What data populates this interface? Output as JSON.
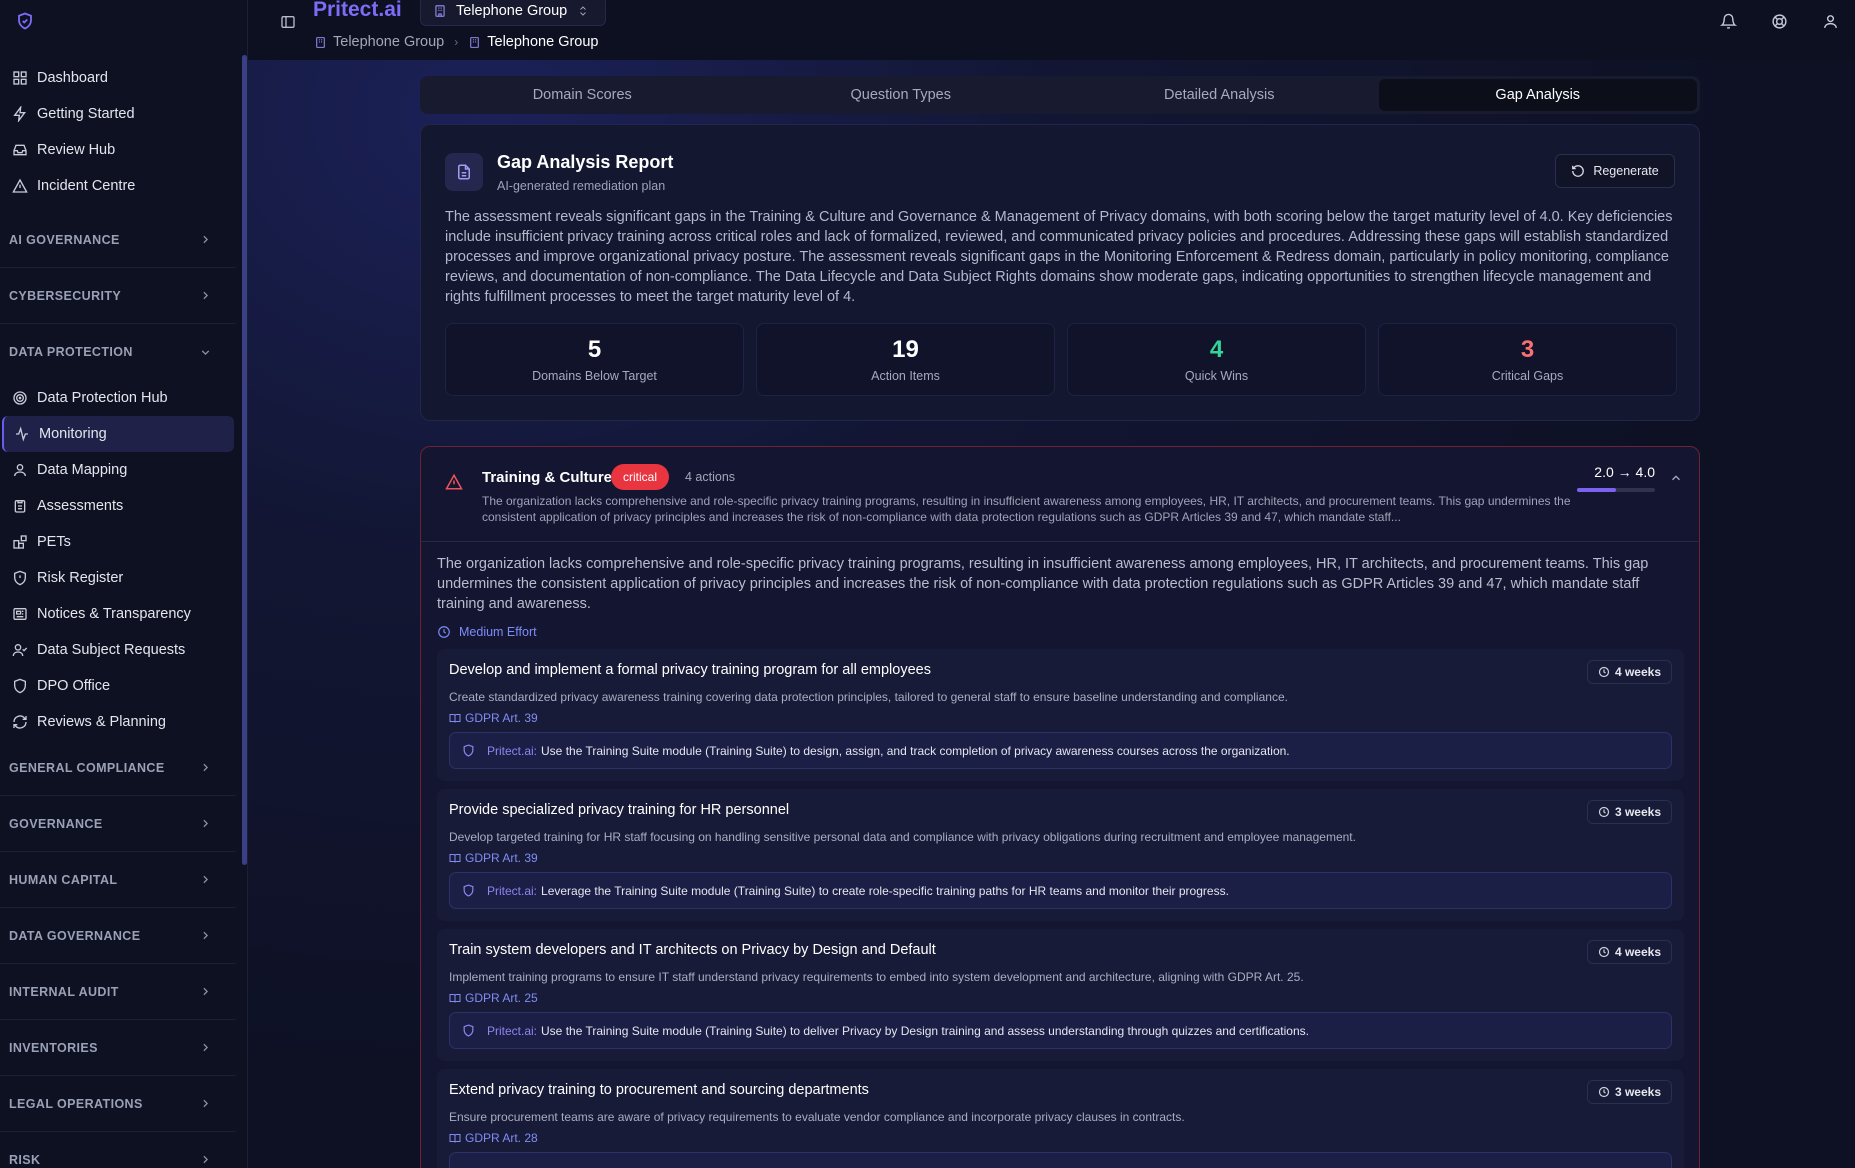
{
  "header": {
    "brand": "Pritect.ai",
    "org_select": "Telephone Group",
    "breadcrumb": [
      "Telephone Group",
      "Telephone Group"
    ]
  },
  "sidebar": {
    "top_items": [
      {
        "label": "Dashboard",
        "icon": "grid-icon"
      },
      {
        "label": "Getting Started",
        "icon": "bolt-icon"
      },
      {
        "label": "Review Hub",
        "icon": "inbox-icon"
      },
      {
        "label": "Incident Centre",
        "icon": "alert-triangle-icon"
      }
    ],
    "sections_before": [
      "AI GOVERNANCE",
      "CYBERSECURITY"
    ],
    "open_section": "DATA PROTECTION",
    "open_items": [
      {
        "label": "Data Protection Hub",
        "icon": "target-icon"
      },
      {
        "label": "Monitoring",
        "icon": "activity-icon",
        "active": true
      },
      {
        "label": "Data Mapping",
        "icon": "map-pin-icon"
      },
      {
        "label": "Assessments",
        "icon": "clipboard-icon"
      },
      {
        "label": "PETs",
        "icon": "blocks-icon"
      },
      {
        "label": "Risk Register",
        "icon": "shield-alert-icon"
      },
      {
        "label": "Notices & Transparency",
        "icon": "newspaper-icon"
      },
      {
        "label": "Data Subject Requests",
        "icon": "user-check-icon"
      },
      {
        "label": "DPO Office",
        "icon": "shield-icon"
      },
      {
        "label": "Reviews & Planning",
        "icon": "refresh-icon"
      }
    ],
    "sections_after": [
      "GENERAL COMPLIANCE",
      "GOVERNANCE",
      "HUMAN CAPITAL",
      "DATA GOVERNANCE",
      "INTERNAL AUDIT",
      "INVENTORIES",
      "LEGAL OPERATIONS",
      "RISK"
    ]
  },
  "tabs": [
    "Domain Scores",
    "Question Types",
    "Detailed Analysis",
    "Gap Analysis"
  ],
  "active_tab": "Gap Analysis",
  "report": {
    "title": "Gap Analysis Report",
    "subtitle": "AI-generated remediation plan",
    "regenerate_label": "Regenerate",
    "summary": "The assessment reveals significant gaps in the Training & Culture and Governance & Management of Privacy domains, with both scoring below the target maturity level of 4.0. Key deficiencies include insufficient privacy training across critical roles and lack of formalized, reviewed, and communicated privacy policies and procedures. Addressing these gaps will establish standardized processes and improve organizational privacy posture. The assessment reveals significant gaps in the Monitoring Enforcement & Redress domain, particularly in policy monitoring, compliance reviews, and documentation of non-compliance. The Data Lifecycle and Data Subject Rights domains show moderate gaps, indicating opportunities to strengthen lifecycle management and rights fulfillment processes to meet the target maturity level of 4.",
    "stats": [
      {
        "value": "5",
        "label": "Domains Below Target",
        "color": "#ffffff"
      },
      {
        "value": "19",
        "label": "Action Items",
        "color": "#ffffff"
      },
      {
        "value": "4",
        "label": "Quick Wins",
        "color": "#34d399"
      },
      {
        "value": "3",
        "label": "Critical Gaps",
        "color": "#f87171"
      }
    ]
  },
  "domain": {
    "title": "Training & Culture",
    "severity": "critical",
    "actions_count": "4 actions",
    "summary": "The organization lacks comprehensive and role-specific privacy training programs, resulting in insufficient awareness among employees, HR, IT architects, and procurement teams. This gap undermines the consistent application of privacy principles and increases the risk of non-compliance with data protection regulations such as GDPR Articles 39 and 47, which mandate staff...",
    "score": "2.0 → 4.0",
    "score_progress": 0.5,
    "description": "The organization lacks comprehensive and role-specific privacy training programs, resulting in insufficient awareness among employees, HR, IT architects, and procurement teams. This gap undermines the consistent application of privacy principles and increases the risk of non-compliance with data protection regulations such as GDPR Articles 39 and 47, which mandate staff training and awareness.",
    "effort": "Medium Effort",
    "actions": [
      {
        "title": "Develop and implement a formal privacy training program for all employees",
        "duration": "4 weeks",
        "description": "Create standardized privacy awareness training covering data protection principles, tailored to general staff to ensure baseline understanding and compliance.",
        "reference": "GDPR Art. 39",
        "tip_brand": "Pritect.ai:",
        "tip": "Use the Training Suite module (Training Suite) to design, assign, and track completion of privacy awareness courses across the organization."
      },
      {
        "title": "Provide specialized privacy training for HR personnel",
        "duration": "3 weeks",
        "description": "Develop targeted training for HR staff focusing on handling sensitive personal data and compliance with privacy obligations during recruitment and employee management.",
        "reference": "GDPR Art. 39",
        "tip_brand": "Pritect.ai:",
        "tip": "Leverage the Training Suite module (Training Suite) to create role-specific training paths for HR teams and monitor their progress."
      },
      {
        "title": "Train system developers and IT architects on Privacy by Design and Default",
        "duration": "4 weeks",
        "description": "Implement training programs to ensure IT staff understand privacy requirements to embed into system development and architecture, aligning with GDPR Art. 25.",
        "reference": "GDPR Art. 25",
        "tip_brand": "Pritect.ai:",
        "tip": "Use the Training Suite module (Training Suite) to deliver Privacy by Design training and assess understanding through quizzes and certifications."
      },
      {
        "title": "Extend privacy training to procurement and sourcing departments",
        "duration": "3 weeks",
        "description": "Ensure procurement teams are aware of privacy requirements to evaluate vendor compliance and incorporate privacy clauses in contracts.",
        "reference": "GDPR Art. 28",
        "tip_brand": "",
        "tip": ""
      }
    ]
  },
  "colors": {
    "accent": "#7c6cf6",
    "critical": "#e8353f",
    "quick_wins": "#34d399",
    "critical_gaps": "#f87171"
  }
}
